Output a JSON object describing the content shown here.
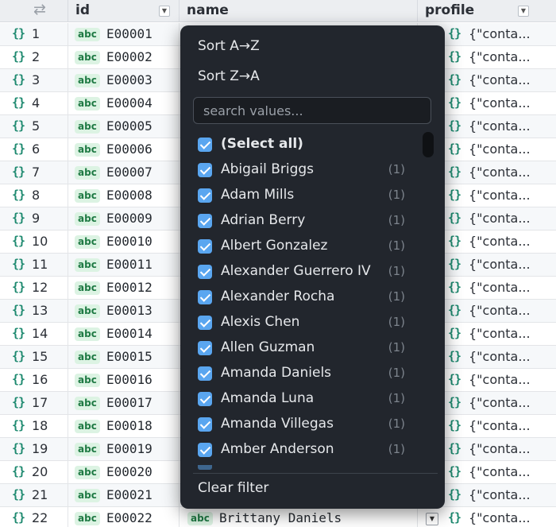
{
  "table": {
    "columns": [
      {
        "key": "index",
        "label": "⇄"
      },
      {
        "key": "id",
        "label": "id"
      },
      {
        "key": "name",
        "label": "name"
      },
      {
        "key": "profile",
        "label": "profile"
      }
    ],
    "type_badge": "abc",
    "object_icon": "{}",
    "rows": [
      {
        "index": "1",
        "id": "E00001",
        "profile": "{\"conta..."
      },
      {
        "index": "2",
        "id": "E00002",
        "profile": "{\"conta..."
      },
      {
        "index": "3",
        "id": "E00003",
        "profile": "{\"conta..."
      },
      {
        "index": "4",
        "id": "E00004",
        "profile": "{\"conta..."
      },
      {
        "index": "5",
        "id": "E00005",
        "profile": "{\"conta..."
      },
      {
        "index": "6",
        "id": "E00006",
        "profile": "{\"conta..."
      },
      {
        "index": "7",
        "id": "E00007",
        "profile": "{\"conta..."
      },
      {
        "index": "8",
        "id": "E00008",
        "profile": "{\"conta..."
      },
      {
        "index": "9",
        "id": "E00009",
        "profile": "{\"conta..."
      },
      {
        "index": "10",
        "id": "E00010",
        "profile": "{\"conta..."
      },
      {
        "index": "11",
        "id": "E00011",
        "profile": "{\"conta..."
      },
      {
        "index": "12",
        "id": "E00012",
        "profile": "{\"conta..."
      },
      {
        "index": "13",
        "id": "E00013",
        "profile": "{\"conta..."
      },
      {
        "index": "14",
        "id": "E00014",
        "profile": "{\"conta..."
      },
      {
        "index": "15",
        "id": "E00015",
        "profile": "{\"conta..."
      },
      {
        "index": "16",
        "id": "E00016",
        "profile": "{\"conta..."
      },
      {
        "index": "17",
        "id": "E00017",
        "profile": "{\"conta..."
      },
      {
        "index": "18",
        "id": "E00018",
        "profile": "{\"conta..."
      },
      {
        "index": "19",
        "id": "E00019",
        "profile": "{\"conta..."
      },
      {
        "index": "20",
        "id": "E00020",
        "profile": "{\"conta..."
      },
      {
        "index": "21",
        "id": "E00021",
        "profile": "{\"conta..."
      },
      {
        "index": "22",
        "id": "E00022",
        "name": "Brittany Daniels",
        "profile": "{\"conta..."
      }
    ]
  },
  "filter_menu": {
    "sort_asc": "Sort A→Z",
    "sort_desc": "Sort Z→A",
    "search_placeholder": "search values...",
    "select_all": "(Select all)",
    "options": [
      {
        "label": "Abigail Briggs",
        "count": "(1)",
        "checked": true
      },
      {
        "label": "Adam Mills",
        "count": "(1)",
        "checked": true
      },
      {
        "label": "Adrian Berry",
        "count": "(1)",
        "checked": true
      },
      {
        "label": "Albert Gonzalez",
        "count": "(1)",
        "checked": true
      },
      {
        "label": "Alexander Guerrero IV",
        "count": "(1)",
        "checked": true
      },
      {
        "label": "Alexander Rocha",
        "count": "(1)",
        "checked": true
      },
      {
        "label": "Alexis Chen",
        "count": "(1)",
        "checked": true
      },
      {
        "label": "Allen Guzman",
        "count": "(1)",
        "checked": true
      },
      {
        "label": "Amanda Daniels",
        "count": "(1)",
        "checked": true
      },
      {
        "label": "Amanda Luna",
        "count": "(1)",
        "checked": true
      },
      {
        "label": "Amanda Villegas",
        "count": "(1)",
        "checked": true
      },
      {
        "label": "Amber Anderson",
        "count": "(1)",
        "checked": true
      }
    ],
    "clear_filter": "Clear filter"
  },
  "colors": {
    "menu_bg": "#22262d",
    "checkbox": "#5aa6f0",
    "badge_bg": "#dcf3e3",
    "badge_fg": "#1f7a44",
    "object_icon": "#1f8a70"
  }
}
